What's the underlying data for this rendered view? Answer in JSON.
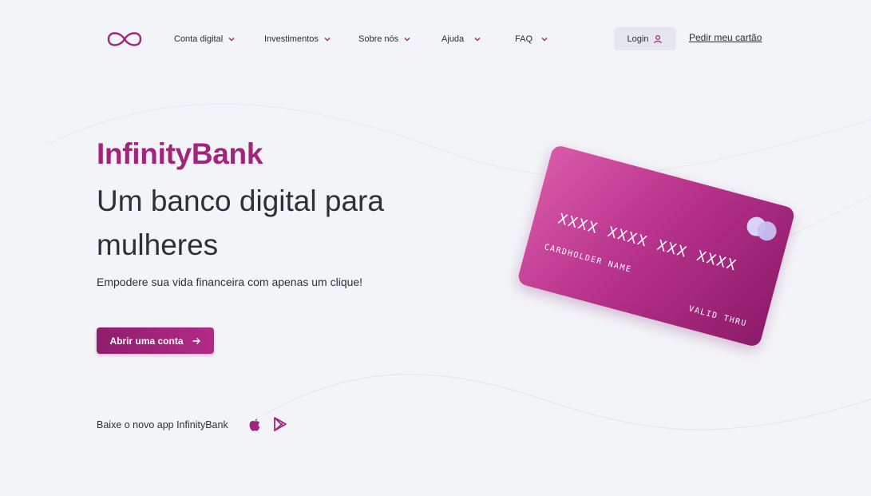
{
  "brand": {
    "logo_icon": "infinity-icon",
    "accent_color": "#a3247c"
  },
  "nav": {
    "items": [
      {
        "label": "Conta digital"
      },
      {
        "label": "Investimentos"
      },
      {
        "label": "Sobre nós"
      },
      {
        "label": "Ajuda"
      },
      {
        "label": "FAQ"
      }
    ],
    "login_label": "Login",
    "login_icon": "user-icon",
    "card_link": "Pedir meu cartão"
  },
  "hero": {
    "brand_name": "InfinityBank",
    "headline": "Um banco digital para mulheres",
    "subtitle": "Empodere sua vida financeira com apenas um clique!",
    "cta_label": "Abrir uma conta",
    "cta_icon": "arrow-right-icon"
  },
  "card": {
    "number": "XXXX XXXX XXX XXXX",
    "holder": "CARDHOLDER NAME",
    "valid": "VALID THRU"
  },
  "app": {
    "text": "Baixe o novo app InfinityBank",
    "icons": [
      "apple-icon",
      "google-play-icon"
    ]
  }
}
